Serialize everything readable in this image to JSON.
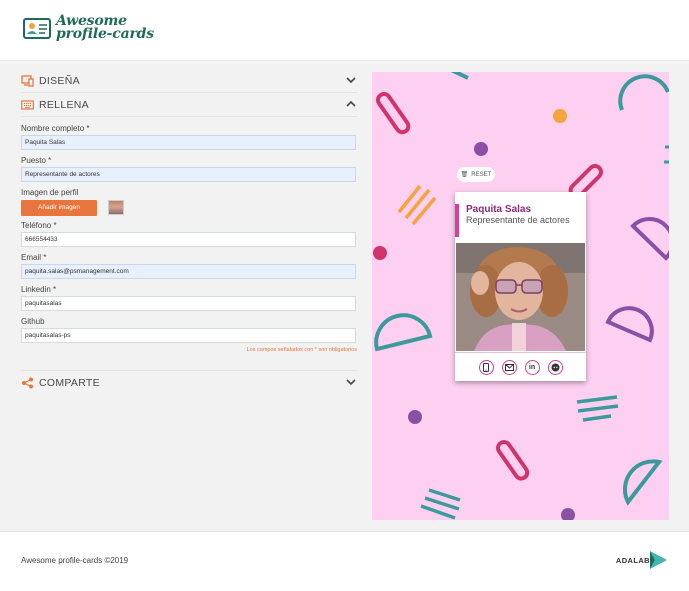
{
  "header": {
    "logo_line1": "Awesome",
    "logo_line2": "profile-cards"
  },
  "sections": {
    "design_label": "DISEÑA",
    "fill_label": "RELLENA",
    "share_label": "COMPARTE"
  },
  "form": {
    "name_label": "Nombre completo *",
    "name_value": "Paquita Salas",
    "job_label": "Puesto *",
    "job_value": "Representante de actores",
    "image_label": "Imagen de perfil",
    "add_image_button": "Añadir imagen",
    "phone_label": "Teléfono *",
    "phone_value": "666554433",
    "email_label": "Email *",
    "email_value": "paquita.salas@psmanagement.com",
    "linkedin_label": "Linkedin *",
    "linkedin_value": "paquitasalas",
    "github_label": "Github",
    "github_value": "paquitasalas-ps",
    "required_note": "Los campos señalados con * son obligatorios"
  },
  "preview": {
    "reset_label": "RESET",
    "card_name": "Paquita Salas",
    "card_job": "Representante de actores",
    "social_icons": [
      "phone-icon",
      "mail-icon",
      "linkedin-icon",
      "github-icon"
    ],
    "linkedin_text": "in"
  },
  "footer": {
    "copyright": "Awesome profile-cards ©2019",
    "brand": "ADALAB"
  },
  "colors": {
    "accent_orange": "#e7753d",
    "logo_green": "#1f6b5a",
    "preview_bg": "#fdd0f2",
    "card_accent": "#d13f9f",
    "shape_teal": "#3d9a9b",
    "shape_magenta": "#d1336b",
    "shape_purple": "#8b4fa6",
    "shape_orange": "#f4a43a"
  }
}
